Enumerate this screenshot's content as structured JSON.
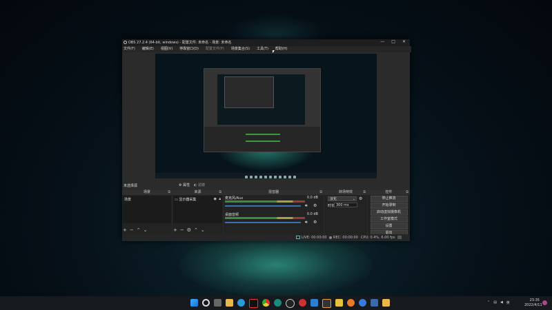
{
  "window": {
    "title": "OBS 27.2.4 (64-bit, windows) - 配置文件: 未命名 - 场景: 未命名",
    "controls": [
      "—",
      "□",
      "✕"
    ]
  },
  "menu": [
    "文件(F)",
    "编辑(E)",
    "视图(V)",
    "停靠窗口(D)",
    "配置文件(P)",
    "场景集合(S)",
    "工具(T)",
    "帮助(H)"
  ],
  "status": {
    "no_source": "未选择源",
    "properties_label": "属性",
    "filters_label": "滤镜"
  },
  "docks": {
    "scenes": {
      "title": "场景",
      "items": [
        "场景"
      ]
    },
    "sources": {
      "title": "来源",
      "items": [
        "显示器采集"
      ]
    },
    "mixer": {
      "title": "混音器",
      "channels": [
        {
          "name": "麦克风/Aux",
          "db": "0.0 dB"
        },
        {
          "name": "桌面音频",
          "db": "0.0 dB"
        }
      ]
    },
    "transitions": {
      "title": "转场特效",
      "type": "淡化",
      "duration_label": "时长",
      "duration_value": "300 ms"
    },
    "controls": {
      "title": "控件",
      "buttons": [
        "停止推流",
        "开始录制",
        "启动虚拟摄像机",
        "工作室模式",
        "设置",
        "退出"
      ]
    }
  },
  "statusbar": {
    "live": "LIVE: 00:00:00",
    "rec": "REC: 00:00:00",
    "cpu": "CPU: 0.4%, 6.00 fps"
  },
  "taskbar": {
    "icons": [
      "windows-start-icon",
      "search-icon",
      "file-explorer-icon",
      "folder-icon",
      "edge-icon",
      "tiktok-icon",
      "chrome-icon",
      "edge-dev-icon",
      "obs-icon",
      "obs-icon-2",
      "vscode-icon",
      "g-app-icon",
      "app-icon-1",
      "app-icon-2",
      "app-icon-3",
      "steam-icon",
      "app-icon-4"
    ],
    "lang": "英",
    "time": "23:35",
    "date": "2022/4/11"
  },
  "colors": {
    "meter_green": "#3b8f3b",
    "meter_yellow": "#a8a33a",
    "meter_red": "#a23a3a",
    "volume_blue": "#3a6fb0",
    "taskbar_bg": "#16191d"
  }
}
